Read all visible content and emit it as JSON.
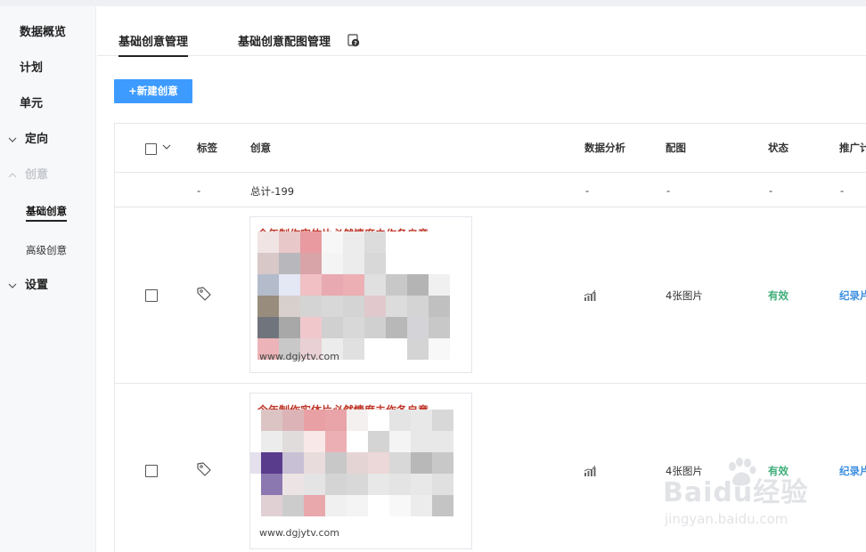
{
  "sidebar": {
    "items": [
      {
        "label": "数据概览"
      },
      {
        "label": "计划"
      },
      {
        "label": "单元"
      },
      {
        "label": "定向"
      },
      {
        "label": "创意"
      },
      {
        "label": "基础创意"
      },
      {
        "label": "高级创意"
      },
      {
        "label": "设置"
      }
    ]
  },
  "tabs": {
    "basic": "基础创意管理",
    "image": "基础创意配图管理",
    "help_icon": "help-doc-icon"
  },
  "toolbar": {
    "new_label": "+新建创意"
  },
  "table": {
    "columns": {
      "tag": "标签",
      "creative": "创意",
      "analysis": "数据分析",
      "image": "配图",
      "status": "状态",
      "promo": "推广计"
    },
    "total_row": {
      "tag": "-",
      "creative": "总计-199",
      "analysis": "-",
      "image": "-",
      "status": "-",
      "promo": "-"
    },
    "rows": [
      {
        "title": "今年制作实体片必然情度未作各自意",
        "url": "www.dgjytv.com",
        "image": "4张图片",
        "status": "有效",
        "promo": "纪录片"
      },
      {
        "title": "今年制作实体片必然情度未作各自意",
        "url": "www.dgjytv.com",
        "image": "4张图片",
        "status": "有效",
        "promo": "纪录片"
      }
    ]
  },
  "watermark": {
    "brand": "Baidu经验",
    "url": "jingyan.baidu.com"
  },
  "colors": {
    "primary": "#3d9bff",
    "status_ok": "#3fae7a",
    "link": "#3d8fe0",
    "creative_title": "#c0392b"
  }
}
